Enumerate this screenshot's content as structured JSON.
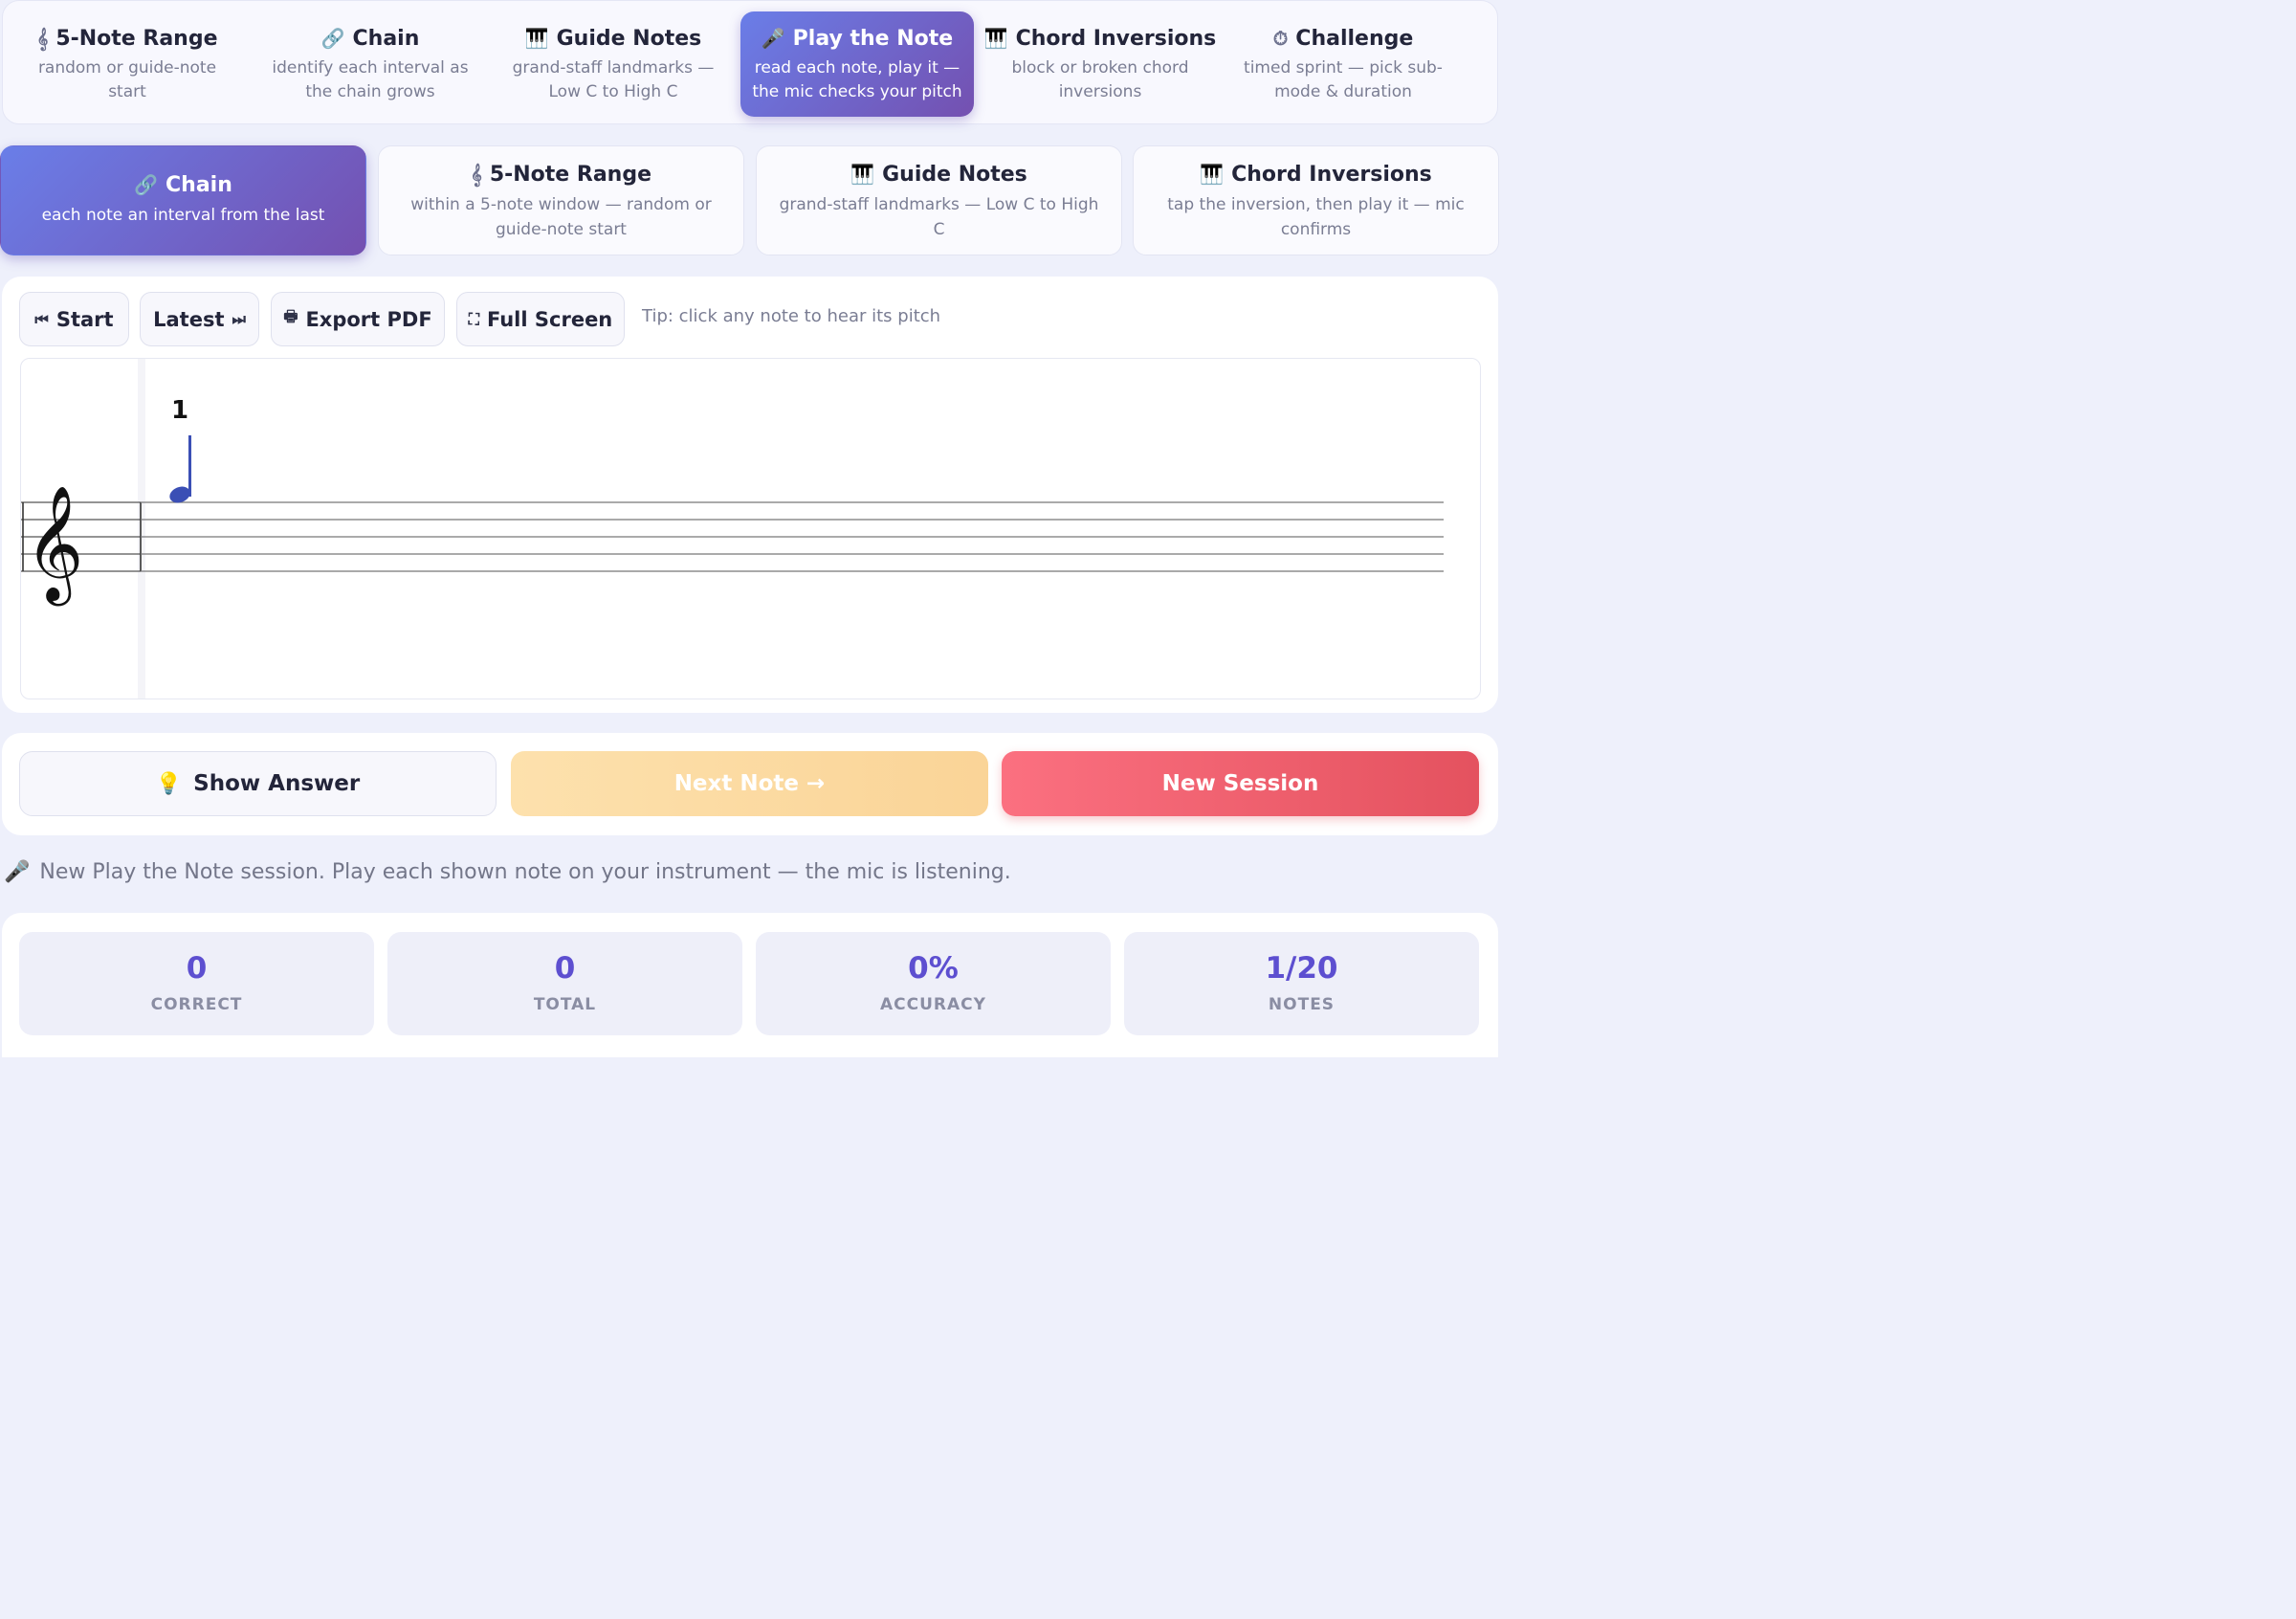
{
  "modes": [
    {
      "icon": "𝄞",
      "icon_name": "treble-clef-icon",
      "title": "5-Note Range",
      "desc": "random or guide-note start",
      "active": false
    },
    {
      "icon": "🔗",
      "icon_name": "link-icon",
      "title": "Chain",
      "desc": "identify each interval as the chain grows",
      "active": false
    },
    {
      "icon": "🎹",
      "icon_name": "piano-icon",
      "title": "Guide Notes",
      "desc": "grand-staff landmarks — Low C to High C",
      "active": false
    },
    {
      "icon": "🎤",
      "icon_name": "microphone-icon",
      "title": "Play the Note",
      "desc": "read each note, play it — the mic checks your pitch",
      "active": true
    },
    {
      "icon": "🎹",
      "icon_name": "piano-icon",
      "title": "Chord Inversions",
      "desc": "block or broken chord inversions",
      "active": false
    },
    {
      "icon": "⏱",
      "icon_name": "stopwatch-icon",
      "title": "Challenge",
      "desc": "timed sprint — pick sub-mode & duration",
      "active": false
    }
  ],
  "submodes": [
    {
      "icon": "🔗",
      "icon_name": "link-icon",
      "title": "Chain",
      "desc": "each note an interval from the last",
      "active": true
    },
    {
      "icon": "𝄞",
      "icon_name": "treble-clef-icon",
      "title": "5-Note Range",
      "desc": "within a 5-note window — random or guide-note start",
      "active": false
    },
    {
      "icon": "🎹",
      "icon_name": "piano-icon",
      "title": "Guide Notes",
      "desc": "grand-staff landmarks — Low C to High C",
      "active": false
    },
    {
      "icon": "🎹",
      "icon_name": "piano-icon",
      "title": "Chord Inversions",
      "desc": "tap the inversion, then play it — mic confirms",
      "active": false
    }
  ],
  "toolbar": {
    "start_label": "Start",
    "latest_label": "Latest",
    "export_label": "Export PDF",
    "fullscreen_label": "Full Screen",
    "tip": "Tip: click any note to hear its pitch"
  },
  "staff": {
    "clef": "treble",
    "notes": [
      {
        "number": "1",
        "pitch": "G5",
        "duration": "quarter",
        "color": "#3b4fb5"
      }
    ]
  },
  "actions": {
    "show_answer": "Show Answer",
    "next_note": "Next Note →",
    "new_session": "New Session"
  },
  "status": {
    "icon_name": "microphone-icon",
    "message": "New Play the Note session. Play each shown note on your instrument — the mic is listening."
  },
  "stats": [
    {
      "value": "0",
      "label": "CORRECT"
    },
    {
      "value": "0",
      "label": "TOTAL"
    },
    {
      "value": "0%",
      "label": "ACCURACY"
    },
    {
      "value": "1/20",
      "label": "NOTES"
    }
  ],
  "colors": {
    "accent_gradient_start": "#6a7ee8",
    "accent_gradient_end": "#7450b0",
    "stat_value": "#5d4fd0",
    "new_session": "#f06170",
    "next_note_disabled": "#fbd9a0",
    "note_color": "#3b4fb5"
  }
}
